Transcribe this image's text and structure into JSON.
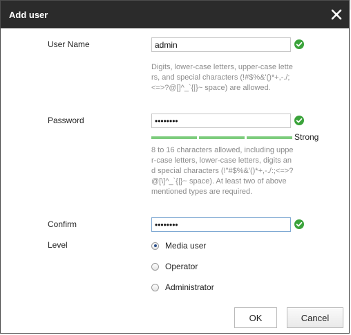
{
  "dialog": {
    "title": "Add user",
    "close_icon": "close-icon"
  },
  "form": {
    "username": {
      "label": "User Name",
      "value": "admin",
      "hint": "Digits, lower-case letters, upper-case letters, and special characters (!#$%&'()*+,-./;<=>?@[]^_`{|}~ space) are allowed.",
      "valid_icon": "check-circle-icon"
    },
    "password": {
      "label": "Password",
      "value": "aaaaaaaa",
      "strength": "Strong",
      "strength_level": 1.0,
      "hint": "8 to 16 characters allowed, including upper-case letters, lower-case letters, digits and special characters (!\"#$%&'()*+,-./:;<=>?@[\\]^_`{|}~ space). At least two of above mentioned types are required.",
      "valid_icon": "check-circle-icon"
    },
    "confirm": {
      "label": "Confirm",
      "value": "aaaaaaaa",
      "valid_icon": "check-circle-icon"
    },
    "level": {
      "label": "Level",
      "options": [
        {
          "label": "Media user",
          "checked": true
        },
        {
          "label": "Operator",
          "checked": false
        },
        {
          "label": "Administrator",
          "checked": false
        }
      ]
    }
  },
  "buttons": {
    "ok": "OK",
    "cancel": "Cancel"
  },
  "colors": {
    "titlebar": "#2b2b2b",
    "valid": "#3aa33a",
    "strength": "#7ccc7c"
  }
}
